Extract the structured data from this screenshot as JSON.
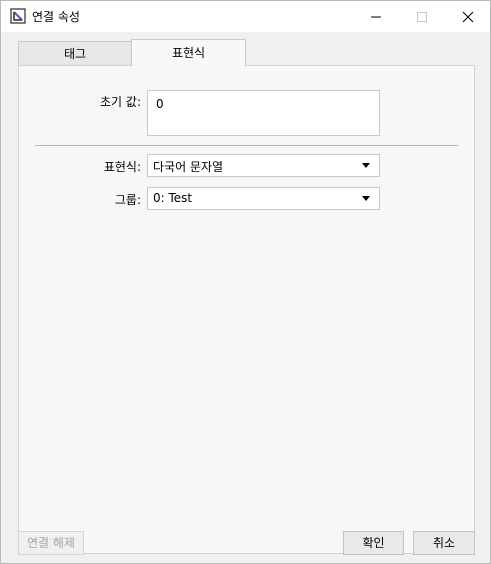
{
  "window": {
    "title": "연결 속성",
    "controls": {
      "minimize": "minimize",
      "maximize": "maximize",
      "close": "close"
    }
  },
  "tabs": [
    {
      "label": "태그",
      "selected": false
    },
    {
      "label": "표현식",
      "selected": true
    }
  ],
  "form": {
    "initial_value": {
      "label": "초기 값:",
      "value": "0"
    },
    "expression": {
      "label": "표현식:",
      "value": "다국어 문자열"
    },
    "group": {
      "label": "그룹:",
      "value": "0: Test"
    }
  },
  "footer": {
    "disconnect_label": "연결 해제",
    "ok_label": "확인",
    "cancel_label": "취소"
  },
  "colors": {
    "accent_icon": "#4a69bd",
    "button_bg": "#e9e9e9",
    "panel_bg": "#f7f7f7"
  }
}
